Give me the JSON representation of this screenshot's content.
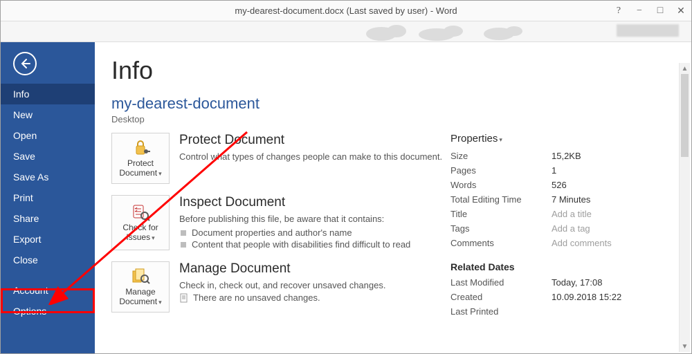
{
  "title": "my-dearest-document.docx (Last saved by user) - Word",
  "window_controls": {
    "help": "?",
    "min": "−",
    "max": "□",
    "close": "✕"
  },
  "sidebar": {
    "items": [
      "Info",
      "New",
      "Open",
      "Save",
      "Save As",
      "Print",
      "Share",
      "Export",
      "Close"
    ],
    "bottom": [
      "Account",
      "Options"
    ],
    "selected": 0
  },
  "page": {
    "heading": "Info",
    "doc_name": "my-dearest-document",
    "doc_location": "Desktop"
  },
  "sections": {
    "protect": {
      "btn_label": "Protect Document",
      "title": "Protect Document",
      "desc": "Control what types of changes people can make to this document."
    },
    "inspect": {
      "btn_label": "Check for Issues",
      "title": "Inspect Document",
      "desc": "Before publishing this file, be aware that it contains:",
      "bullets": [
        "Document properties and author's name",
        "Content that people with disabilities find difficult to read"
      ]
    },
    "manage": {
      "btn_label": "Manage Document",
      "title": "Manage Document",
      "desc": "Check in, check out, and recover unsaved changes.",
      "note": "There are no unsaved changes."
    }
  },
  "properties": {
    "heading": "Properties",
    "rows": [
      {
        "k": "Size",
        "v": "15,2KB"
      },
      {
        "k": "Pages",
        "v": "1"
      },
      {
        "k": "Words",
        "v": "526"
      },
      {
        "k": "Total Editing Time",
        "v": "7 Minutes"
      },
      {
        "k": "Title",
        "v": "Add a title",
        "ph": true
      },
      {
        "k": "Tags",
        "v": "Add a tag",
        "ph": true
      },
      {
        "k": "Comments",
        "v": "Add comments",
        "ph": true
      }
    ],
    "dates_heading": "Related Dates",
    "dates": [
      {
        "k": "Last Modified",
        "v": "Today, 17:08"
      },
      {
        "k": "Created",
        "v": "10.09.2018 15:22"
      },
      {
        "k": "Last Printed",
        "v": ""
      }
    ]
  }
}
